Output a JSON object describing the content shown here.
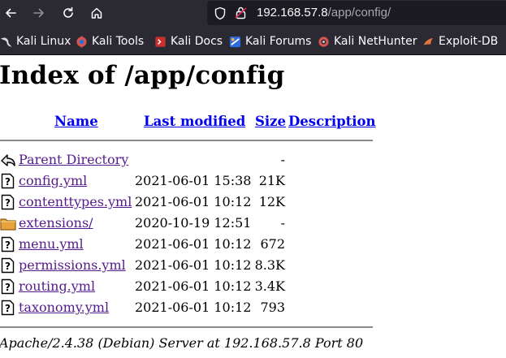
{
  "browser": {
    "url_host": "192.168.57.8",
    "url_path": "/app/config/",
    "bookmarks": [
      {
        "label": "Kali Linux",
        "icon": "kali-dragon-icon"
      },
      {
        "label": "Kali Tools",
        "icon": "kali-tools-icon"
      },
      {
        "label": "Kali Docs",
        "icon": "kali-docs-icon"
      },
      {
        "label": "Kali Forums",
        "icon": "kali-forums-icon"
      },
      {
        "label": "Kali NetHunter",
        "icon": "kali-nethunter-icon"
      },
      {
        "label": "Exploit-DB",
        "icon": "exploit-db-icon"
      }
    ]
  },
  "page": {
    "title": "Index of /app/config",
    "columns": {
      "name": "Name",
      "last_modified": "Last modified",
      "size": "Size",
      "description": "Description"
    },
    "rows": [
      {
        "name": "Parent Directory",
        "date": "",
        "size": "-",
        "icon": "back-arrow-icon"
      },
      {
        "name": "config.yml",
        "date": "2021-06-01 15:38",
        "size": "21K",
        "icon": "unknown-file-icon"
      },
      {
        "name": "contenttypes.yml",
        "date": "2021-06-01 10:12",
        "size": "12K",
        "icon": "unknown-file-icon"
      },
      {
        "name": "extensions/",
        "date": "2020-10-19 12:51",
        "size": "-",
        "icon": "folder-icon"
      },
      {
        "name": "menu.yml",
        "date": "2021-06-01 10:12",
        "size": "672",
        "icon": "unknown-file-icon"
      },
      {
        "name": "permissions.yml",
        "date": "2021-06-01 10:12",
        "size": "8.3K",
        "icon": "unknown-file-icon"
      },
      {
        "name": "routing.yml",
        "date": "2021-06-01 10:12",
        "size": "3.4K",
        "icon": "unknown-file-icon"
      },
      {
        "name": "taxonomy.yml",
        "date": "2021-06-01 10:12",
        "size": "793",
        "icon": "unknown-file-icon"
      }
    ],
    "footer": "Apache/2.4.38 (Debian) Server at 192.168.57.8 Port 80"
  }
}
